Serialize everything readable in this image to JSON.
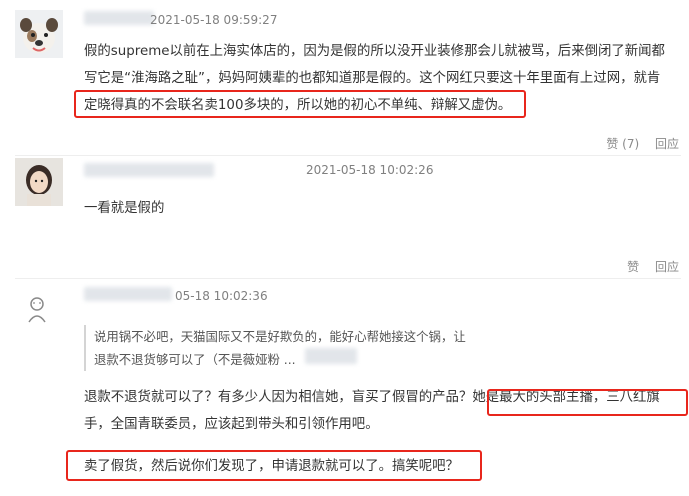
{
  "comments": [
    {
      "timestamp": "2021-05-18 09:59:27",
      "text_lines": [
        "假的supreme以前在上海实体店的，因为是假的所以没开业装修那会儿就被骂，后来倒闭了新闻都",
        "写它是“淮海路之耻”，妈妈阿姨辈的也都知道那是假的。这个网红只要这十年里面有上过网，就肯",
        "定晓得真的不会联名卖100多块的，所以她的初心不单纯、辩解又虚伪。"
      ],
      "like_label": "赞 (7)",
      "reply_label": "回应"
    },
    {
      "timestamp": "2021-05-18 10:02:26",
      "text": "一看就是假的",
      "like_label": "赞",
      "reply_label": "回应"
    },
    {
      "timestamp": "05-18 10:02:36",
      "quote_lines": [
        "说用锅不必吧，天猫国际又不是好欺负的，能好心帮她接这个锅，让",
        "退款不退货够可以了（不是薇娅粉 ..."
      ],
      "text_lines": [
        "退款不退货就可以了？有多少人因为相信她，盲买了假冒的产品？她是最大的头部主播，三八红旗",
        "手，全国青联委员，应该起到带头和引领作用吧。"
      ],
      "highlight_line": "卖了假货，然后说你们发现了，申请退款就可以了。搞笑呢吧？"
    }
  ],
  "colors": {
    "highlight_border": "#e8261c",
    "meta_text": "#808080",
    "body_text": "#333333"
  }
}
